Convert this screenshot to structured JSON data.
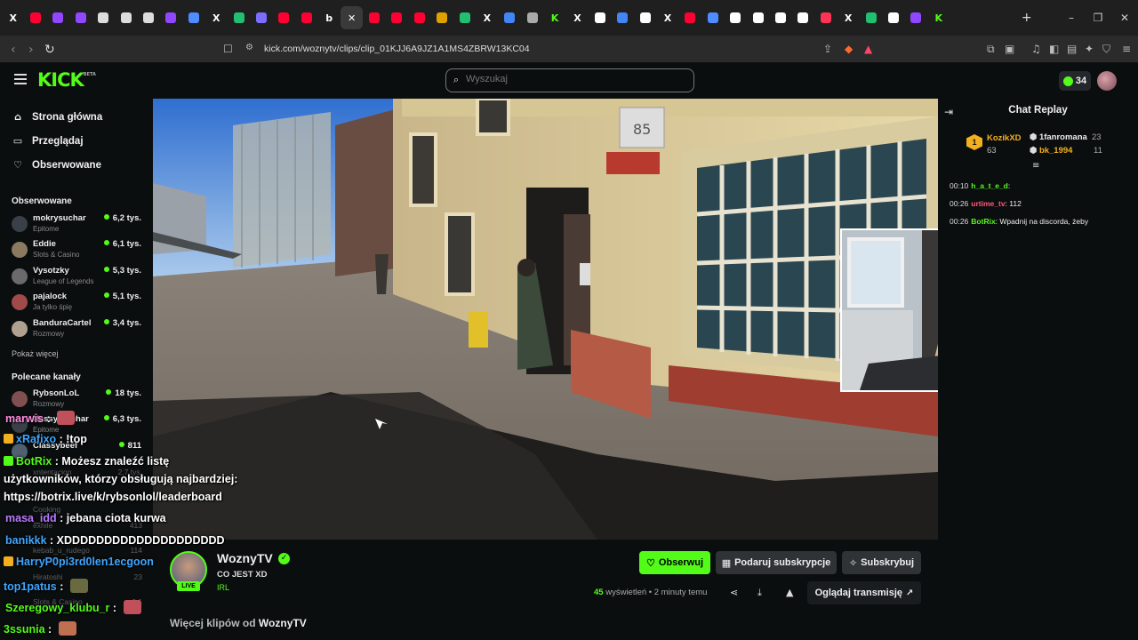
{
  "browser": {
    "tabs": [
      {
        "icon": "x-icon",
        "label": "X",
        "color": "#ffffff"
      },
      {
        "icon": "youtube-icon",
        "label": "",
        "color": "#ff0033"
      },
      {
        "icon": "twitch-icon",
        "label": "",
        "color": "#9146ff"
      },
      {
        "icon": "twitch-icon",
        "label": "",
        "color": "#9146ff"
      },
      {
        "icon": "vod-icon",
        "label": "",
        "color": "#dddddd"
      },
      {
        "icon": "vod-icon",
        "label": "",
        "color": "#dddddd"
      },
      {
        "icon": "vod-icon",
        "label": "",
        "color": "#dddddd"
      },
      {
        "icon": "twitch-icon",
        "label": "",
        "color": "#9146ff"
      },
      {
        "icon": "ai-icon",
        "label": "",
        "color": "#4f8cff"
      },
      {
        "icon": "x-icon",
        "label": "X",
        "color": "#ffffff"
      },
      {
        "icon": "sheet-icon",
        "label": "",
        "color": "#20c070"
      },
      {
        "icon": "copilot-icon",
        "label": "",
        "color": "#7c6cff"
      },
      {
        "icon": "youtube-icon",
        "label": "",
        "color": "#ff0033"
      },
      {
        "icon": "youtube-icon",
        "label": "",
        "color": "#ff0033"
      },
      {
        "icon": "b-icon",
        "label": "b",
        "color": "#ffffff"
      },
      {
        "icon": "close-icon",
        "label": "✕",
        "color": "#ffffff",
        "active": true
      },
      {
        "icon": "youtube-icon",
        "label": "",
        "color": "#ff0033"
      },
      {
        "icon": "youtube-icon",
        "label": "",
        "color": "#ff0033"
      },
      {
        "icon": "youtube-icon",
        "label": "",
        "color": "#ff0033"
      },
      {
        "icon": "chart-icon",
        "label": "",
        "color": "#e0a000"
      },
      {
        "icon": "sheet-icon",
        "label": "",
        "color": "#20c070"
      },
      {
        "icon": "x-icon",
        "label": "X",
        "color": "#ffffff"
      },
      {
        "icon": "google-icon",
        "label": "",
        "color": "#4285f4"
      },
      {
        "icon": "globe-icon",
        "label": "",
        "color": "#aaaaaa"
      },
      {
        "icon": "kick-icon",
        "label": "K",
        "color": "#53fc18"
      },
      {
        "icon": "x-icon",
        "label": "X",
        "color": "#ffffff"
      },
      {
        "icon": "grid-icon",
        "label": "",
        "color": "#ffffff"
      },
      {
        "icon": "google-icon",
        "label": "",
        "color": "#4285f4"
      },
      {
        "icon": "pin-icon",
        "label": "",
        "color": "#ffffff"
      },
      {
        "icon": "x-icon",
        "label": "X",
        "color": "#ffffff"
      },
      {
        "icon": "youtube-icon",
        "label": "",
        "color": "#ff0033"
      },
      {
        "icon": "ai-icon",
        "label": "",
        "color": "#4f8cff"
      },
      {
        "icon": "tiktok-icon",
        "label": "",
        "color": "#ffffff"
      },
      {
        "icon": "pin-icon",
        "label": "",
        "color": "#ffffff"
      },
      {
        "icon": "whatsapp-icon",
        "label": "",
        "color": "#ffffff"
      },
      {
        "icon": "doc-icon",
        "label": "",
        "color": "#ffffff"
      },
      {
        "icon": "record-icon",
        "label": "",
        "color": "#ff3355"
      },
      {
        "icon": "x-icon",
        "label": "X",
        "color": "#ffffff"
      },
      {
        "icon": "sheet-icon",
        "label": "",
        "color": "#20c070"
      },
      {
        "icon": "doc-icon",
        "label": "",
        "color": "#ffffff"
      },
      {
        "icon": "twitch-icon",
        "label": "",
        "color": "#9146ff"
      },
      {
        "icon": "kick-icon",
        "label": "K",
        "color": "#53fc18"
      }
    ],
    "new_tab": "+",
    "window_controls": [
      "–",
      "❐",
      "✕"
    ],
    "url": "kick.com/woznytv/clips/clip_01KJJ6A9JZ1A1MS4ZBRW13KC04"
  },
  "header": {
    "logo": "KICK",
    "logo_beta": "BETA",
    "search_placeholder": "Wyszukaj",
    "kicks_count": "34"
  },
  "sidebar": {
    "nav": [
      {
        "icon": "home-icon",
        "label": "Strona główna"
      },
      {
        "icon": "browse-icon",
        "label": "Przeglądaj"
      },
      {
        "icon": "heart-icon",
        "label": "Obserwowane"
      }
    ],
    "followed_title": "Obserwowane",
    "followed": [
      {
        "name": "mokrysuchar",
        "category": "Epitome",
        "viewers": "6,2 tys.",
        "color": "#3a4048"
      },
      {
        "name": "Eddie",
        "category": "Slots & Casino",
        "viewers": "6,1 tys.",
        "color": "#8a7a60"
      },
      {
        "name": "Vysotzky",
        "category": "League of Legends",
        "viewers": "5,3 tys.",
        "color": "#6a6a6a"
      },
      {
        "name": "pajalock",
        "category": "Ja tylko śpię",
        "viewers": "5,1 tys.",
        "color": "#a04a4a"
      },
      {
        "name": "BanduraCartel",
        "category": "Rozmowy",
        "viewers": "3,4 tys.",
        "color": "#b0a090"
      }
    ],
    "show_more": "Pokaż więcej",
    "recommended_title": "Polecane kanały",
    "recommended": [
      {
        "name": "RybsonLoL",
        "category": "Rozmowy",
        "viewers": "18 tys.",
        "color": "#805050"
      },
      {
        "name": "Hassy Suchar",
        "category": "Epitome",
        "viewers": "6,3 tys.",
        "color": "#3a4048"
      },
      {
        "name": "Classybeef",
        "category": "",
        "viewers": "811",
        "color": "#506070"
      }
    ]
  },
  "overlay_chat": [
    {
      "user": "marwis",
      "color": "#ff8de0",
      "text": " : ",
      "badge": "",
      "emote": "#c0505a"
    },
    {
      "user": "xRafixo",
      "color": "#3ea6ff",
      "text": " : !top",
      "badge": "#f2b01e",
      "emote": ""
    },
    {
      "user": "BotRix",
      "color": "#53fc18",
      "text": " : Możesz znaleźć listę",
      "badge": "#53fc18",
      "emote": ""
    },
    {
      "user": "",
      "color": "#ffffff",
      "text": "użytkowników, którzy obsługują najbardziej:",
      "badge": "",
      "emote": ""
    },
    {
      "user": "",
      "color": "#ffffff",
      "text": "https://botrix.live/k/rybsonlol/leaderboard",
      "badge": "",
      "emote": ""
    },
    {
      "user": "masa_idd",
      "color": "#b97bff",
      "text": " : jebana ciota kurwa",
      "badge": "",
      "emote": ""
    },
    {
      "user": "banikkk",
      "color": "#3ea6ff",
      "text": " : XDDDDDDDDDDDDDDDDDDDD",
      "badge": "",
      "emote": ""
    },
    {
      "user": "HarryP0pi3rd0len1ecgoon",
      "color": "#3ea6ff",
      "text": "",
      "badge": "#f2b01e",
      "emote": ""
    },
    {
      "user": "top1patus",
      "color": "#3ea6ff",
      "text": " : ",
      "badge": "",
      "emote": "#6a6a40"
    },
    {
      "user": "Szeregowy_klubu_r",
      "color": "#53fc18",
      "text": " : ",
      "badge": "",
      "emote": "#c0505a"
    },
    {
      "user": "3ssunia",
      "color": "#53fc18",
      "text": " : ",
      "badge": "",
      "emote": "#c07050"
    }
  ],
  "overlay_bg_channels": [
    {
      "name": "xntentacion",
      "viewers": "2,7 tys."
    },
    {
      "name": "Cooking",
      "viewers": ""
    },
    {
      "name": "exhile",
      "viewers": "413"
    },
    {
      "name": "kebab_u_rudego",
      "viewers": "114"
    },
    {
      "name": "Hiratoshi",
      "viewers": "23"
    },
    {
      "name": "Slots & Casino",
      "viewers": "6,1"
    }
  ],
  "chat": {
    "title": "Chat Replay",
    "top_gifter": {
      "rank": "1",
      "name": "KozikXD",
      "count": "63"
    },
    "gifters": [
      {
        "name": "1fanromana",
        "count": "23",
        "color": "#eeeeee"
      },
      {
        "name": "bk_1994",
        "count": "11",
        "color": "#f2b01e"
      }
    ],
    "messages": [
      {
        "time": "00:10",
        "user": "h_a_t_e_d",
        "color": "#53fc18",
        "text": ":"
      },
      {
        "time": "00:26",
        "user": "urtime_tv",
        "color": "#ff5a7a",
        "text": ": 112"
      },
      {
        "time": "00:26",
        "user": "BotRix",
        "color": "#53fc18",
        "text": ": Wpadnij na discorda, żeby"
      }
    ]
  },
  "clip": {
    "streamer": "WoznyTV",
    "live": "LIVE",
    "title": "CO JEST XD",
    "category": "IRL",
    "follow": "Obserwuj",
    "gift_subs": "Podaruj subskrypcje",
    "subscribe": "Subskrybuj",
    "views_count": "45",
    "views_label": "wyświetleń",
    "time_ago": "• 2 minuty temu",
    "watch_stream": "Oglądaj transmisję",
    "more_clips_prefix": "Więcej klipów od",
    "more_clips_name": "WoznyTV"
  },
  "colors": {
    "accent": "#53fc18",
    "bg": "#0b0e0f"
  }
}
